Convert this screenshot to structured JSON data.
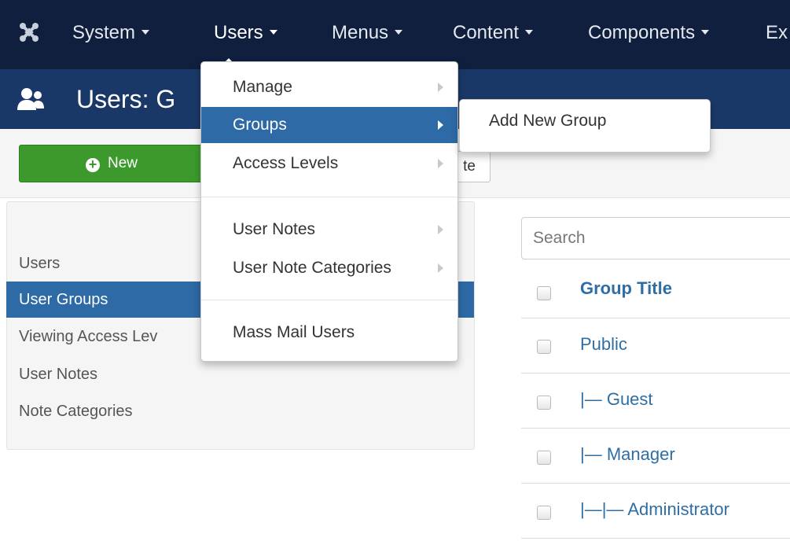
{
  "topnav": {
    "items": [
      {
        "label": "System",
        "active": false
      },
      {
        "label": "Users",
        "active": true
      },
      {
        "label": "Menus",
        "active": false
      },
      {
        "label": "Content",
        "active": false
      },
      {
        "label": "Components",
        "active": false
      },
      {
        "label": "Ex",
        "active": false
      }
    ]
  },
  "subhead": {
    "title": "Users: G"
  },
  "toolbar": {
    "new_label": "New",
    "other_label": "te"
  },
  "sidebar": {
    "items": [
      {
        "label": "Users",
        "active": false
      },
      {
        "label": "User Groups",
        "active": true
      },
      {
        "label": "Viewing Access Lev",
        "active": false
      },
      {
        "label": "User Notes",
        "active": false
      },
      {
        "label": "Note Categories",
        "active": false
      }
    ]
  },
  "search": {
    "placeholder": "Search"
  },
  "table": {
    "header": "Group Title",
    "rows": [
      "Public",
      "|— Guest",
      "|— Manager",
      "|—|— Administrator"
    ]
  },
  "dropdown": {
    "items": [
      {
        "label": "Manage",
        "active": false
      },
      {
        "label": "Groups",
        "active": true
      },
      {
        "label": "Access Levels",
        "active": false
      },
      {
        "label": "User Notes",
        "active": false
      },
      {
        "label": "User Note Categories",
        "active": false
      },
      {
        "label": "Mass Mail Users",
        "active": false
      }
    ],
    "submenu_item": "Add New Group"
  },
  "colors": {
    "topbar": "#0f1f3d",
    "subhead": "#1a3867",
    "accent": "#2e6aa5",
    "new_button": "#3c9a2c"
  }
}
